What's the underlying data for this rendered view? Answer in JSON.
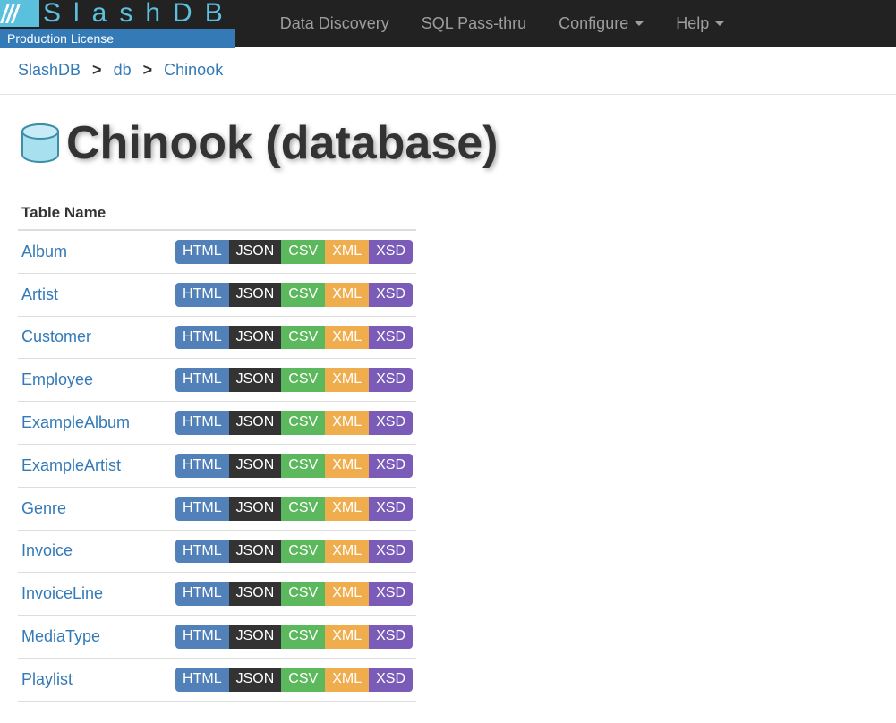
{
  "brand": {
    "name": "SlashDB",
    "license": "Production License"
  },
  "nav": {
    "discovery": "Data Discovery",
    "passthru": "SQL Pass-thru",
    "configure": "Configure",
    "help": "Help"
  },
  "breadcrumb": {
    "items": [
      {
        "label": "SlashDB"
      },
      {
        "label": "db"
      },
      {
        "label": "Chinook"
      }
    ],
    "sep": ">"
  },
  "page_title": "Chinook (database)",
  "table_header": "Table Name",
  "badges": {
    "html": "HTML",
    "json": "JSON",
    "csv": "CSV",
    "xml": "XML",
    "xsd": "XSD"
  },
  "tables": [
    {
      "name": "Album"
    },
    {
      "name": "Artist"
    },
    {
      "name": "Customer"
    },
    {
      "name": "Employee"
    },
    {
      "name": "ExampleAlbum"
    },
    {
      "name": "ExampleArtist"
    },
    {
      "name": "Genre"
    },
    {
      "name": "Invoice"
    },
    {
      "name": "InvoiceLine"
    },
    {
      "name": "MediaType"
    },
    {
      "name": "Playlist"
    }
  ]
}
